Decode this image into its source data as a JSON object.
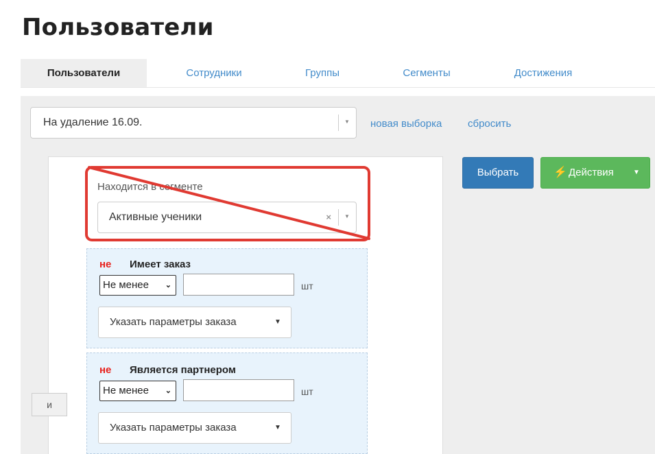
{
  "page": {
    "title": "Пользователи"
  },
  "tabs": [
    {
      "label": "Пользователи",
      "active": true
    },
    {
      "label": "Сотрудники",
      "active": false
    },
    {
      "label": "Группы",
      "active": false
    },
    {
      "label": "Сегменты",
      "active": false
    },
    {
      "label": "Достижения",
      "active": false
    }
  ],
  "filter": {
    "saved_selection": "На удаление 16.09.",
    "new_selection_link": "новая выборка",
    "reset_link": "сбросить"
  },
  "conditions": {
    "logic_operator": "и",
    "segment": {
      "label": "Находится в сегменте",
      "value": "Активные ученики",
      "clear_glyph": "×"
    },
    "order": {
      "negation": "не",
      "title": "Имеет заказ",
      "comparator": "Не менее",
      "quantity": "",
      "unit": "шт",
      "params_button": "Указать параметры заказа"
    },
    "partner": {
      "negation": "не",
      "title": "Является партнером",
      "comparator": "Не менее",
      "quantity": "",
      "unit": "шт",
      "params_button": "Указать параметры заказа"
    }
  },
  "actions": {
    "select_button": "Выбрать",
    "actions_button": "Действия"
  },
  "icons": {
    "dropdown": "chevron-down-icon",
    "bolt": "bolt-icon",
    "clear": "close-icon"
  },
  "colors": {
    "link": "#428bca",
    "primary": "#337ab7",
    "success": "#5cb85c",
    "negation": "#e8201b",
    "annotation": "#e03a32",
    "condition_bg": "#e8f3fc"
  }
}
